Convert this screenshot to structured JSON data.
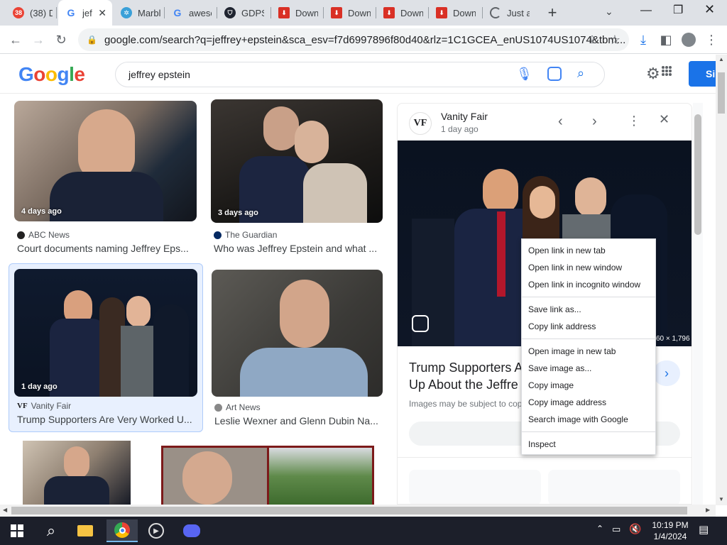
{
  "tabs": [
    {
      "label": "(38) D",
      "favicon": "youtube-badge-icon"
    },
    {
      "label": "jef",
      "favicon": "google-icon"
    },
    {
      "label": "Marbl",
      "favicon": "marble-icon"
    },
    {
      "label": "aweso",
      "favicon": "google-icon"
    },
    {
      "label": "GDPS",
      "favicon": "shield-icon"
    },
    {
      "label": "Downl",
      "favicon": "download-red-icon"
    },
    {
      "label": "Downl",
      "favicon": "download-red-icon"
    },
    {
      "label": "Downl",
      "favicon": "download-red-icon"
    },
    {
      "label": "Downl",
      "favicon": "download-red-icon"
    },
    {
      "label": "Just a",
      "favicon": "loading-icon"
    }
  ],
  "address": {
    "url": "google.com/search?q=jeffrey+epstein&sca_esv=f7d6997896f80d40&rlz=1C1GCEA_enUS1074US1074&tbm..."
  },
  "search": {
    "query": "jeffrey epstein",
    "signin_label": "Si"
  },
  "results": [
    {
      "badge": "4 days ago",
      "source": "ABC News",
      "title": "Court documents naming Jeffrey Eps..."
    },
    {
      "badge": "3 days ago",
      "source": "The Guardian",
      "title": "Who was Jeffrey Epstein and what ..."
    },
    {
      "badge": "1 day ago",
      "source": "Vanity Fair",
      "title": "Trump Supporters Are Very Worked U..."
    },
    {
      "badge": "",
      "source": "Art News",
      "title": "Leslie Wexner and Glenn Dubin Na..."
    }
  ],
  "preview": {
    "source": "Vanity Fair",
    "time": "1 day ago",
    "logo": "VF",
    "dimensions": "60 × 1,796",
    "title_line1": "Trump Supporters A",
    "title_line2": "Up About the Jeffre",
    "note": "Images may be subject to cop"
  },
  "context_menu": {
    "groups": [
      [
        "Open link in new tab",
        "Open link in new window",
        "Open link in incognito window"
      ],
      [
        "Save link as...",
        "Copy link address"
      ],
      [
        "Open image in new tab",
        "Save image as...",
        "Copy image",
        "Copy image address",
        "Search image with Google"
      ],
      [
        "Inspect"
      ]
    ]
  },
  "taskbar": {
    "time": "10:19 PM",
    "date": "1/4/2024"
  },
  "colors": {
    "google_blue": "#4285f4",
    "google_red": "#ea4335",
    "google_yellow": "#fbbc05",
    "google_green": "#34a853",
    "accent": "#1a73e8",
    "taskbar": "#1c1f2a"
  }
}
